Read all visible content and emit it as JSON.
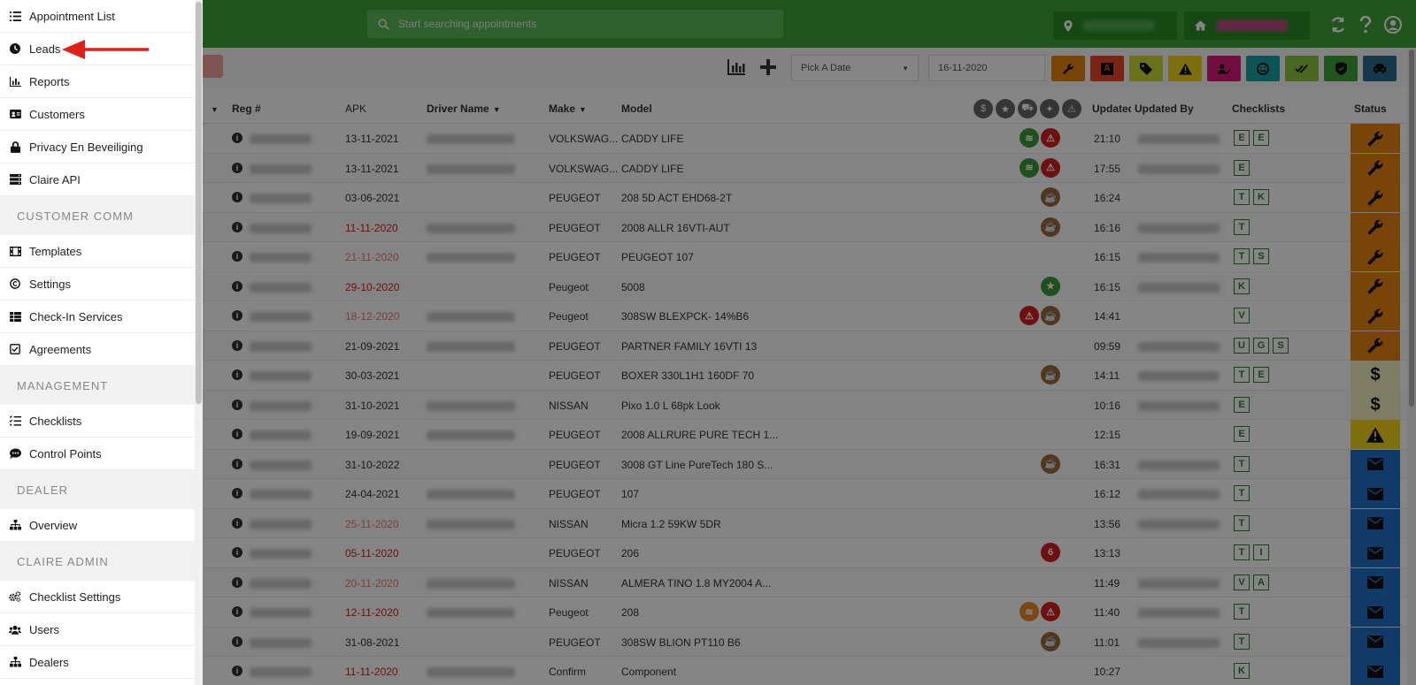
{
  "header": {
    "search_placeholder": "Start searching appointments"
  },
  "toolbar": {
    "date_placeholder": "Pick A Date",
    "date_value": "16-11-2020"
  },
  "table": {
    "headers": {
      "reg": "Reg #",
      "apk": "APK",
      "driver": "Driver Name",
      "make": "Make",
      "model": "Model",
      "updated": "Updated",
      "updated_by": "Updated By",
      "checklists": "Checklists",
      "status": "Status"
    },
    "rows": [
      {
        "apk": "13-11-2021",
        "apk_color": "normal",
        "make": "VOLKSWAG...",
        "model": "CADDY LIFE",
        "icons": [
          "fibre",
          "warning"
        ],
        "time": "21:10",
        "checklists": [
          "E",
          "E"
        ],
        "status": "wrench"
      },
      {
        "apk": "13-11-2021",
        "apk_color": "normal",
        "make": "VOLKSWAG...",
        "model": "CADDY LIFE",
        "icons": [
          "fibre",
          "warning"
        ],
        "time": "17:55",
        "checklists": [
          "E"
        ],
        "status": "wrench"
      },
      {
        "apk": "03-06-2021",
        "apk_color": "normal",
        "make": "PEUGEOT",
        "model": "208 5D ACT EHD68-2T",
        "icons": [
          "coffee"
        ],
        "time": "16:24",
        "checklists": [
          "T",
          "K"
        ],
        "status": "wrench"
      },
      {
        "apk": "11-11-2020",
        "apk_color": "red",
        "make": "PEUGEOT",
        "model": "2008 ALLR 16VTI-AUT",
        "icons": [
          "coffee"
        ],
        "time": "16:16",
        "checklists": [
          "T"
        ],
        "status": "wrench"
      },
      {
        "apk": "21-11-2020",
        "apk_color": "pink",
        "make": "PEUGEOT",
        "model": "PEUGEOT 107",
        "icons": [],
        "time": "16:15",
        "checklists": [
          "T",
          "S"
        ],
        "status": "wrench"
      },
      {
        "apk": "29-10-2020",
        "apk_color": "red",
        "make": "Peugeot",
        "model": "5008",
        "icons": [
          "star"
        ],
        "time": "16:15",
        "checklists": [
          "K"
        ],
        "status": "wrench"
      },
      {
        "apk": "18-12-2020",
        "apk_color": "pink",
        "make": "Peugeot",
        "model": "308SW BLEXPCK- 14%B6",
        "icons": [
          "warning",
          "coffee"
        ],
        "time": "14:41",
        "checklists": [
          "V"
        ],
        "status": "wrench"
      },
      {
        "apk": "21-09-2021",
        "apk_color": "normal",
        "make": "PEUGEOT",
        "model": "PARTNER FAMILY 16VTI 13",
        "icons": [],
        "time": "09:59",
        "checklists": [
          "U",
          "G",
          "S"
        ],
        "status": "wrench"
      },
      {
        "apk": "30-03-2021",
        "apk_color": "normal",
        "make": "PEUGEOT",
        "model": "BOXER 330L1H1 160DF 70",
        "icons": [
          "coffee"
        ],
        "time": "14:11",
        "checklists": [
          "T",
          "E"
        ],
        "status": "dollar"
      },
      {
        "apk": "31-10-2021",
        "apk_color": "normal",
        "make": "NISSAN",
        "model": "Pixo 1.0 L 68pk Look",
        "icons": [],
        "time": "10:16",
        "checklists": [
          "E"
        ],
        "status": "dollar"
      },
      {
        "apk": "19-09-2021",
        "apk_color": "normal",
        "make": "PEUGEOT",
        "model": "2008 ALLRURE PURE TECH 1...",
        "icons": [],
        "time": "12:15",
        "checklists": [
          "E"
        ],
        "status": "warning"
      },
      {
        "apk": "31-10-2022",
        "apk_color": "normal",
        "make": "PEUGEOT",
        "model": "3008 GT Line PureTech 180 S...",
        "icons": [
          "coffee"
        ],
        "time": "16:31",
        "checklists": [
          "T"
        ],
        "status": "mail"
      },
      {
        "apk": "24-04-2021",
        "apk_color": "normal",
        "make": "PEUGEOT",
        "model": "107",
        "icons": [],
        "time": "16:12",
        "checklists": [
          "T"
        ],
        "status": "mail"
      },
      {
        "apk": "25-11-2020",
        "apk_color": "pink",
        "make": "NISSAN",
        "model": "Micra 1.2 59KW 5DR",
        "icons": [],
        "time": "13:56",
        "checklists": [
          "T"
        ],
        "status": "mail"
      },
      {
        "apk": "05-11-2020",
        "apk_color": "red",
        "make": "PEUGEOT",
        "model": "206",
        "icons": [
          "six"
        ],
        "time": "13:13",
        "checklists": [
          "T",
          "I"
        ],
        "status": "mail"
      },
      {
        "apk": "20-11-2020",
        "apk_color": "pink",
        "make": "NISSAN",
        "model": "ALMERA TINO 1.8 MY2004 A...",
        "icons": [],
        "time": "11:49",
        "checklists": [
          "V",
          "A"
        ],
        "status": "mail"
      },
      {
        "apk": "12-11-2020",
        "apk_color": "red",
        "make": "Peugeot",
        "model": "208",
        "icons": [
          "fibre-orange",
          "warning"
        ],
        "time": "11:40",
        "checklists": [
          "T"
        ],
        "status": "mail"
      },
      {
        "apk": "31-08-2021",
        "apk_color": "normal",
        "make": "PEUGEOT",
        "model": "308SW BLION PT110 B6",
        "icons": [
          "coffee"
        ],
        "time": "11:01",
        "checklists": [
          "T"
        ],
        "status": "mail"
      },
      {
        "apk": "11-11-2020",
        "apk_color": "red",
        "make": "Confirm",
        "model": "Component",
        "icons": [],
        "time": "10:27",
        "checklists": [
          "K"
        ],
        "status": "mail"
      }
    ]
  },
  "sidebar": {
    "items": [
      {
        "type": "item",
        "label": "Appointment List",
        "icon": "list-icon"
      },
      {
        "type": "item",
        "label": "Leads",
        "icon": "clock-icon"
      },
      {
        "type": "item",
        "label": "Reports",
        "icon": "bar-chart-icon"
      },
      {
        "type": "item",
        "label": "Customers",
        "icon": "id-card-icon"
      },
      {
        "type": "item",
        "label": "Privacy En Beveiliging",
        "icon": "lock-icon"
      },
      {
        "type": "item",
        "label": "Claire API",
        "icon": "server-icon"
      },
      {
        "type": "section",
        "label": "CUSTOMER COMM"
      },
      {
        "type": "item",
        "label": "Templates",
        "icon": "film-icon"
      },
      {
        "type": "item",
        "label": "Settings",
        "icon": "copyright-icon"
      },
      {
        "type": "item",
        "label": "Check-In Services",
        "icon": "table-icon"
      },
      {
        "type": "item",
        "label": "Agreements",
        "icon": "check-square-icon"
      },
      {
        "type": "section",
        "label": "MANAGEMENT"
      },
      {
        "type": "item",
        "label": "Checklists",
        "icon": "tasks-icon"
      },
      {
        "type": "item",
        "label": "Control Points",
        "icon": "comment-dots-icon"
      },
      {
        "type": "section",
        "label": "DEALER"
      },
      {
        "type": "item",
        "label": "Overview",
        "icon": "sitemap-icon"
      },
      {
        "type": "section",
        "label": "CLAIRE ADMIN"
      },
      {
        "type": "item",
        "label": "Checklist Settings",
        "icon": "cogs-icon"
      },
      {
        "type": "item",
        "label": "Users",
        "icon": "users-icon"
      },
      {
        "type": "item",
        "label": "Dealers",
        "icon": "sitemap-icon"
      }
    ]
  },
  "colors": {
    "topbar": "#3fa33a",
    "wrench": "#e8820e",
    "dollar": "#f2f0c0",
    "warning": "#f2d319",
    "mail": "#1f72c9",
    "arrow": "#e0201b"
  }
}
